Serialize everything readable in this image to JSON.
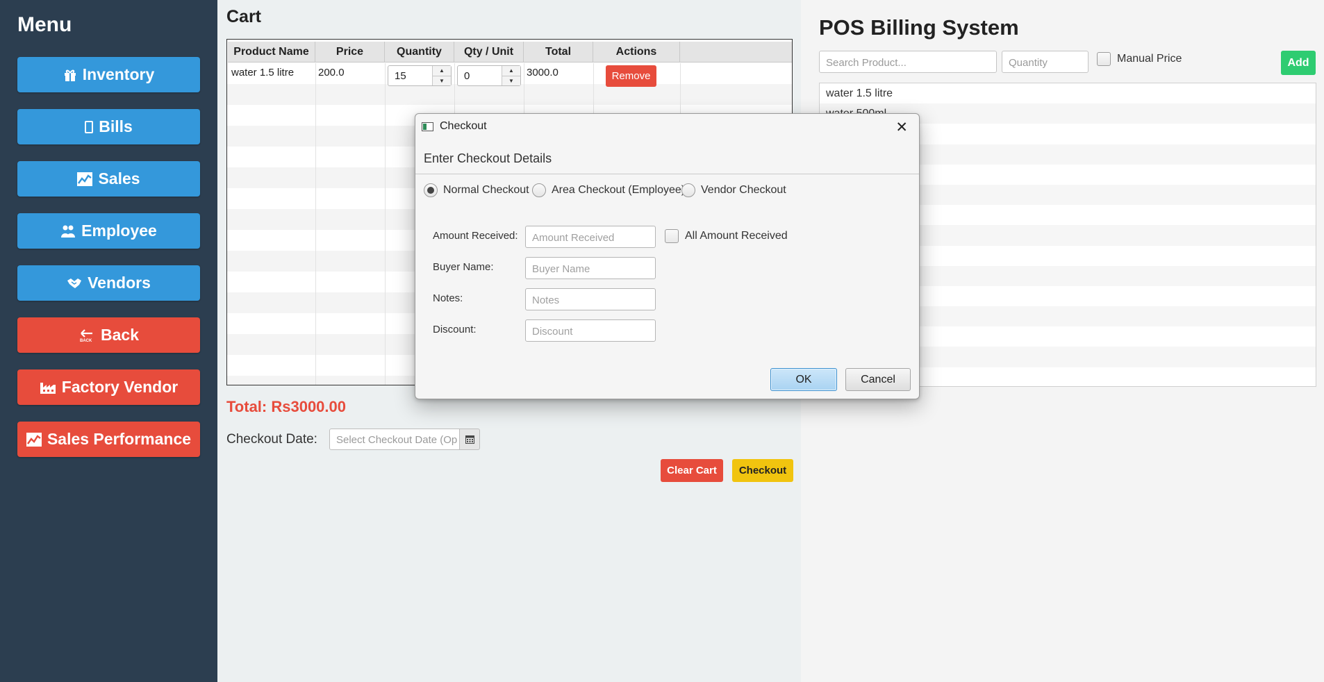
{
  "sidebar": {
    "title": "Menu",
    "buttons": [
      {
        "label": "Inventory",
        "icon": "gift-icon",
        "color": "#3498db"
      },
      {
        "label": "Bills",
        "icon": "receipt-icon",
        "color": "#3498db"
      },
      {
        "label": "Sales",
        "icon": "chart-icon",
        "color": "#3498db"
      },
      {
        "label": "Employee",
        "icon": "users-icon",
        "color": "#3498db"
      },
      {
        "label": "Vendors",
        "icon": "handshake-icon",
        "color": "#3498db"
      },
      {
        "label": "Back",
        "icon": "back-icon",
        "color": "#e74c3c"
      },
      {
        "label": "Factory Vendor",
        "icon": "factory-icon",
        "color": "#e74c3c"
      },
      {
        "label": "Sales Performance",
        "icon": "chart-icon",
        "color": "#e74c3c"
      }
    ]
  },
  "cart": {
    "title": "Cart",
    "columns": [
      "Product Name",
      "Price",
      "Quantity",
      "Qty / Unit",
      "Total",
      "Actions"
    ],
    "rows": [
      {
        "product": "water 1.5 litre",
        "price": "200.0",
        "quantity": "15",
        "qty_unit": "0",
        "total": "3000.0",
        "action": "Remove"
      }
    ],
    "total_label": "Total: Rs3000.00",
    "checkout_date_label": "Checkout Date:",
    "checkout_date_placeholder": "Select Checkout Date (Op",
    "clear_cart_label": "Clear Cart",
    "checkout_label": "Checkout"
  },
  "pos": {
    "title": "POS Billing System",
    "search_placeholder": "Search Product...",
    "quantity_placeholder": "Quantity",
    "manual_price_label": "Manual Price",
    "add_label": "Add",
    "products": [
      "water 1.5 litre",
      "water 500ml"
    ]
  },
  "dialog": {
    "title": "Checkout",
    "header": "Enter Checkout Details",
    "radios": [
      {
        "label": "Normal Checkout",
        "selected": true
      },
      {
        "label": "Area Checkout (Employee)",
        "selected": false
      },
      {
        "label": "Vendor Checkout",
        "selected": false
      }
    ],
    "fields": {
      "amount_label": "Amount Received:",
      "amount_placeholder": "Amount Received",
      "all_amount_label": "All Amount Received",
      "buyer_label": "Buyer Name:",
      "buyer_placeholder": "Buyer Name",
      "notes_label": "Notes:",
      "notes_placeholder": "Notes",
      "discount_label": "Discount:",
      "discount_placeholder": "Discount"
    },
    "ok_label": "OK",
    "cancel_label": "Cancel"
  },
  "colors": {
    "sidebar_bg": "#2c3e50",
    "primary_blue": "#3498db",
    "danger_red": "#e74c3c",
    "success_green": "#2ecc71",
    "warning_yellow": "#f1c40f"
  }
}
